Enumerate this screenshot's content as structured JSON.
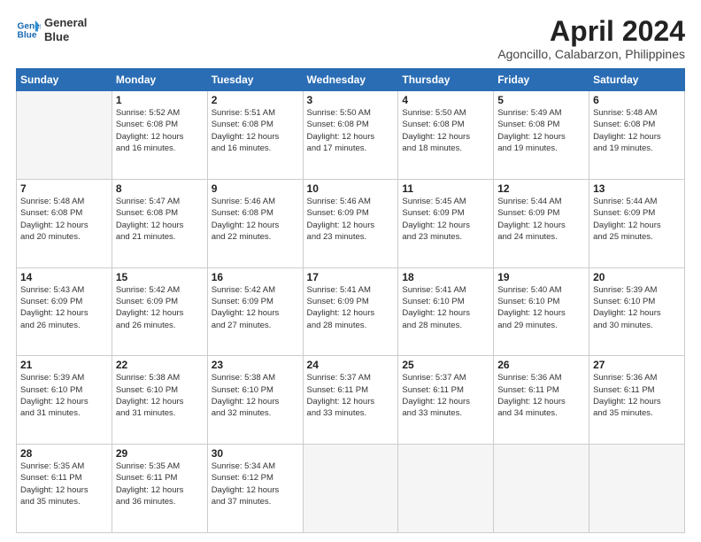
{
  "header": {
    "logo_line1": "General",
    "logo_line2": "Blue",
    "title": "April 2024",
    "subtitle": "Agoncillo, Calabarzon, Philippines"
  },
  "calendar": {
    "headers": [
      "Sunday",
      "Monday",
      "Tuesday",
      "Wednesday",
      "Thursday",
      "Friday",
      "Saturday"
    ],
    "weeks": [
      [
        {
          "day": "",
          "info": ""
        },
        {
          "day": "1",
          "info": "Sunrise: 5:52 AM\nSunset: 6:08 PM\nDaylight: 12 hours\nand 16 minutes."
        },
        {
          "day": "2",
          "info": "Sunrise: 5:51 AM\nSunset: 6:08 PM\nDaylight: 12 hours\nand 16 minutes."
        },
        {
          "day": "3",
          "info": "Sunrise: 5:50 AM\nSunset: 6:08 PM\nDaylight: 12 hours\nand 17 minutes."
        },
        {
          "day": "4",
          "info": "Sunrise: 5:50 AM\nSunset: 6:08 PM\nDaylight: 12 hours\nand 18 minutes."
        },
        {
          "day": "5",
          "info": "Sunrise: 5:49 AM\nSunset: 6:08 PM\nDaylight: 12 hours\nand 19 minutes."
        },
        {
          "day": "6",
          "info": "Sunrise: 5:48 AM\nSunset: 6:08 PM\nDaylight: 12 hours\nand 19 minutes."
        }
      ],
      [
        {
          "day": "7",
          "info": "Sunrise: 5:48 AM\nSunset: 6:08 PM\nDaylight: 12 hours\nand 20 minutes."
        },
        {
          "day": "8",
          "info": "Sunrise: 5:47 AM\nSunset: 6:08 PM\nDaylight: 12 hours\nand 21 minutes."
        },
        {
          "day": "9",
          "info": "Sunrise: 5:46 AM\nSunset: 6:08 PM\nDaylight: 12 hours\nand 22 minutes."
        },
        {
          "day": "10",
          "info": "Sunrise: 5:46 AM\nSunset: 6:09 PM\nDaylight: 12 hours\nand 23 minutes."
        },
        {
          "day": "11",
          "info": "Sunrise: 5:45 AM\nSunset: 6:09 PM\nDaylight: 12 hours\nand 23 minutes."
        },
        {
          "day": "12",
          "info": "Sunrise: 5:44 AM\nSunset: 6:09 PM\nDaylight: 12 hours\nand 24 minutes."
        },
        {
          "day": "13",
          "info": "Sunrise: 5:44 AM\nSunset: 6:09 PM\nDaylight: 12 hours\nand 25 minutes."
        }
      ],
      [
        {
          "day": "14",
          "info": "Sunrise: 5:43 AM\nSunset: 6:09 PM\nDaylight: 12 hours\nand 26 minutes."
        },
        {
          "day": "15",
          "info": "Sunrise: 5:42 AM\nSunset: 6:09 PM\nDaylight: 12 hours\nand 26 minutes."
        },
        {
          "day": "16",
          "info": "Sunrise: 5:42 AM\nSunset: 6:09 PM\nDaylight: 12 hours\nand 27 minutes."
        },
        {
          "day": "17",
          "info": "Sunrise: 5:41 AM\nSunset: 6:09 PM\nDaylight: 12 hours\nand 28 minutes."
        },
        {
          "day": "18",
          "info": "Sunrise: 5:41 AM\nSunset: 6:10 PM\nDaylight: 12 hours\nand 28 minutes."
        },
        {
          "day": "19",
          "info": "Sunrise: 5:40 AM\nSunset: 6:10 PM\nDaylight: 12 hours\nand 29 minutes."
        },
        {
          "day": "20",
          "info": "Sunrise: 5:39 AM\nSunset: 6:10 PM\nDaylight: 12 hours\nand 30 minutes."
        }
      ],
      [
        {
          "day": "21",
          "info": "Sunrise: 5:39 AM\nSunset: 6:10 PM\nDaylight: 12 hours\nand 31 minutes."
        },
        {
          "day": "22",
          "info": "Sunrise: 5:38 AM\nSunset: 6:10 PM\nDaylight: 12 hours\nand 31 minutes."
        },
        {
          "day": "23",
          "info": "Sunrise: 5:38 AM\nSunset: 6:10 PM\nDaylight: 12 hours\nand 32 minutes."
        },
        {
          "day": "24",
          "info": "Sunrise: 5:37 AM\nSunset: 6:11 PM\nDaylight: 12 hours\nand 33 minutes."
        },
        {
          "day": "25",
          "info": "Sunrise: 5:37 AM\nSunset: 6:11 PM\nDaylight: 12 hours\nand 33 minutes."
        },
        {
          "day": "26",
          "info": "Sunrise: 5:36 AM\nSunset: 6:11 PM\nDaylight: 12 hours\nand 34 minutes."
        },
        {
          "day": "27",
          "info": "Sunrise: 5:36 AM\nSunset: 6:11 PM\nDaylight: 12 hours\nand 35 minutes."
        }
      ],
      [
        {
          "day": "28",
          "info": "Sunrise: 5:35 AM\nSunset: 6:11 PM\nDaylight: 12 hours\nand 35 minutes."
        },
        {
          "day": "29",
          "info": "Sunrise: 5:35 AM\nSunset: 6:11 PM\nDaylight: 12 hours\nand 36 minutes."
        },
        {
          "day": "30",
          "info": "Sunrise: 5:34 AM\nSunset: 6:12 PM\nDaylight: 12 hours\nand 37 minutes."
        },
        {
          "day": "",
          "info": ""
        },
        {
          "day": "",
          "info": ""
        },
        {
          "day": "",
          "info": ""
        },
        {
          "day": "",
          "info": ""
        }
      ]
    ]
  }
}
